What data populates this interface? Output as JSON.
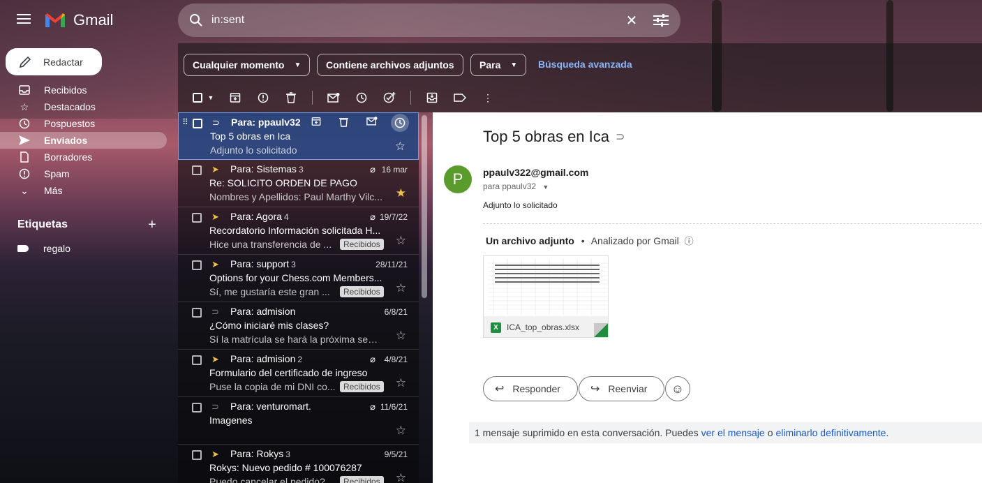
{
  "app": {
    "name": "Gmail"
  },
  "search": {
    "query": "in:sent"
  },
  "compose": {
    "label": "Redactar"
  },
  "nav": [
    {
      "label": "Recibidos",
      "icon": "inbox-icon"
    },
    {
      "label": "Destacados",
      "icon": "star-icon"
    },
    {
      "label": "Pospuestos",
      "icon": "clock-icon"
    },
    {
      "label": "Enviados",
      "icon": "send-icon",
      "active": true
    },
    {
      "label": "Borradores",
      "icon": "draft-icon"
    },
    {
      "label": "Spam",
      "icon": "spam-icon"
    },
    {
      "label": "Más",
      "icon": "chevron-down-icon"
    }
  ],
  "labels": {
    "title": "Etiquetas",
    "items": [
      {
        "label": "regalo"
      }
    ]
  },
  "filters": {
    "any_time": "Cualquier momento",
    "has_attachment": "Contiene archivos adjuntos",
    "to": "Para",
    "advanced": "Búsqueda avanzada"
  },
  "threads": [
    {
      "to": "Para: ppaulv32",
      "count": "",
      "subject": "Top 5 obras en Ica",
      "snippet": "Adjunto lo solicitado",
      "date": "",
      "important": false,
      "starred": false,
      "attachment": false,
      "badge": "",
      "selected": true
    },
    {
      "to": "Para: Sistemas",
      "count": "3",
      "subject": "Re: SOLICITO ORDEN DE PAGO",
      "snippet": "Nombres y Apellidos: Paul Marthy Vilc...",
      "date": "16 mar",
      "important": true,
      "starred": true,
      "attachment": true,
      "badge": ""
    },
    {
      "to": "Para: Agora",
      "count": "4",
      "subject": "Recordatorio Información solicitada H...",
      "snippet": "Hice una transferencia de ...",
      "date": "19/7/22",
      "important": true,
      "starred": false,
      "attachment": true,
      "badge": "Recibidos"
    },
    {
      "to": "Para: support",
      "count": "3",
      "subject": "Options for your Chess.com Members...",
      "snippet": "Sí, me gustaría este gran ...",
      "date": "28/11/21",
      "important": true,
      "starred": false,
      "attachment": false,
      "badge": "Recibidos"
    },
    {
      "to": "Para: admision",
      "count": "",
      "subject": "¿Cómo iniciaré mis clases?",
      "snippet": "Sí la matrícula se hará la próxima sem...",
      "date": "6/8/21",
      "important": false,
      "starred": false,
      "attachment": false,
      "badge": ""
    },
    {
      "to": "Para: admision",
      "count": "2",
      "subject": "Formulario del certificado de ingreso",
      "snippet": "Puse la copia de mi DNI co...",
      "date": "4/8/21",
      "important": true,
      "starred": false,
      "attachment": true,
      "badge": "Recibidos"
    },
    {
      "to": "Para: venturomart.",
      "count": "",
      "subject": "Imagenes",
      "snippet": "",
      "date": "11/6/21",
      "important": false,
      "starred": false,
      "attachment": true,
      "badge": ""
    },
    {
      "to": "Para: Rokys",
      "count": "3",
      "subject": "Rokys: Nuevo pedido # 100076287",
      "snippet": "Puedo cancelar el pedido?",
      "date": "9/5/21",
      "important": true,
      "starred": false,
      "attachment": false,
      "badge": "Recibidos"
    }
  ],
  "message": {
    "subject": "Top 5 obras en Ica",
    "avatar_letter": "P",
    "from": "ppaulv322@gmail.com",
    "to_line": "para ppaulv32",
    "body": "Adjunto lo solicitado",
    "attachment_header": "Un archivo adjunto",
    "attachment_scanned": "Analizado por Gmail",
    "attachment_name": "ICA_top_obras.xlsx",
    "reply": "Responder",
    "forward": "Reenviar",
    "deleted_notice": "1 mensaje suprimido en esta conversación. Puedes",
    "view_link": "ver el mensaje",
    "or": "o",
    "delete_link": "eliminarlo definitivamente",
    "period": "."
  },
  "colors": {
    "selected_row": "#28509a",
    "important": "#f2c044",
    "avatar": "#5a9c2c",
    "link": "#1a57c9",
    "excel": "#1e8e3e"
  }
}
